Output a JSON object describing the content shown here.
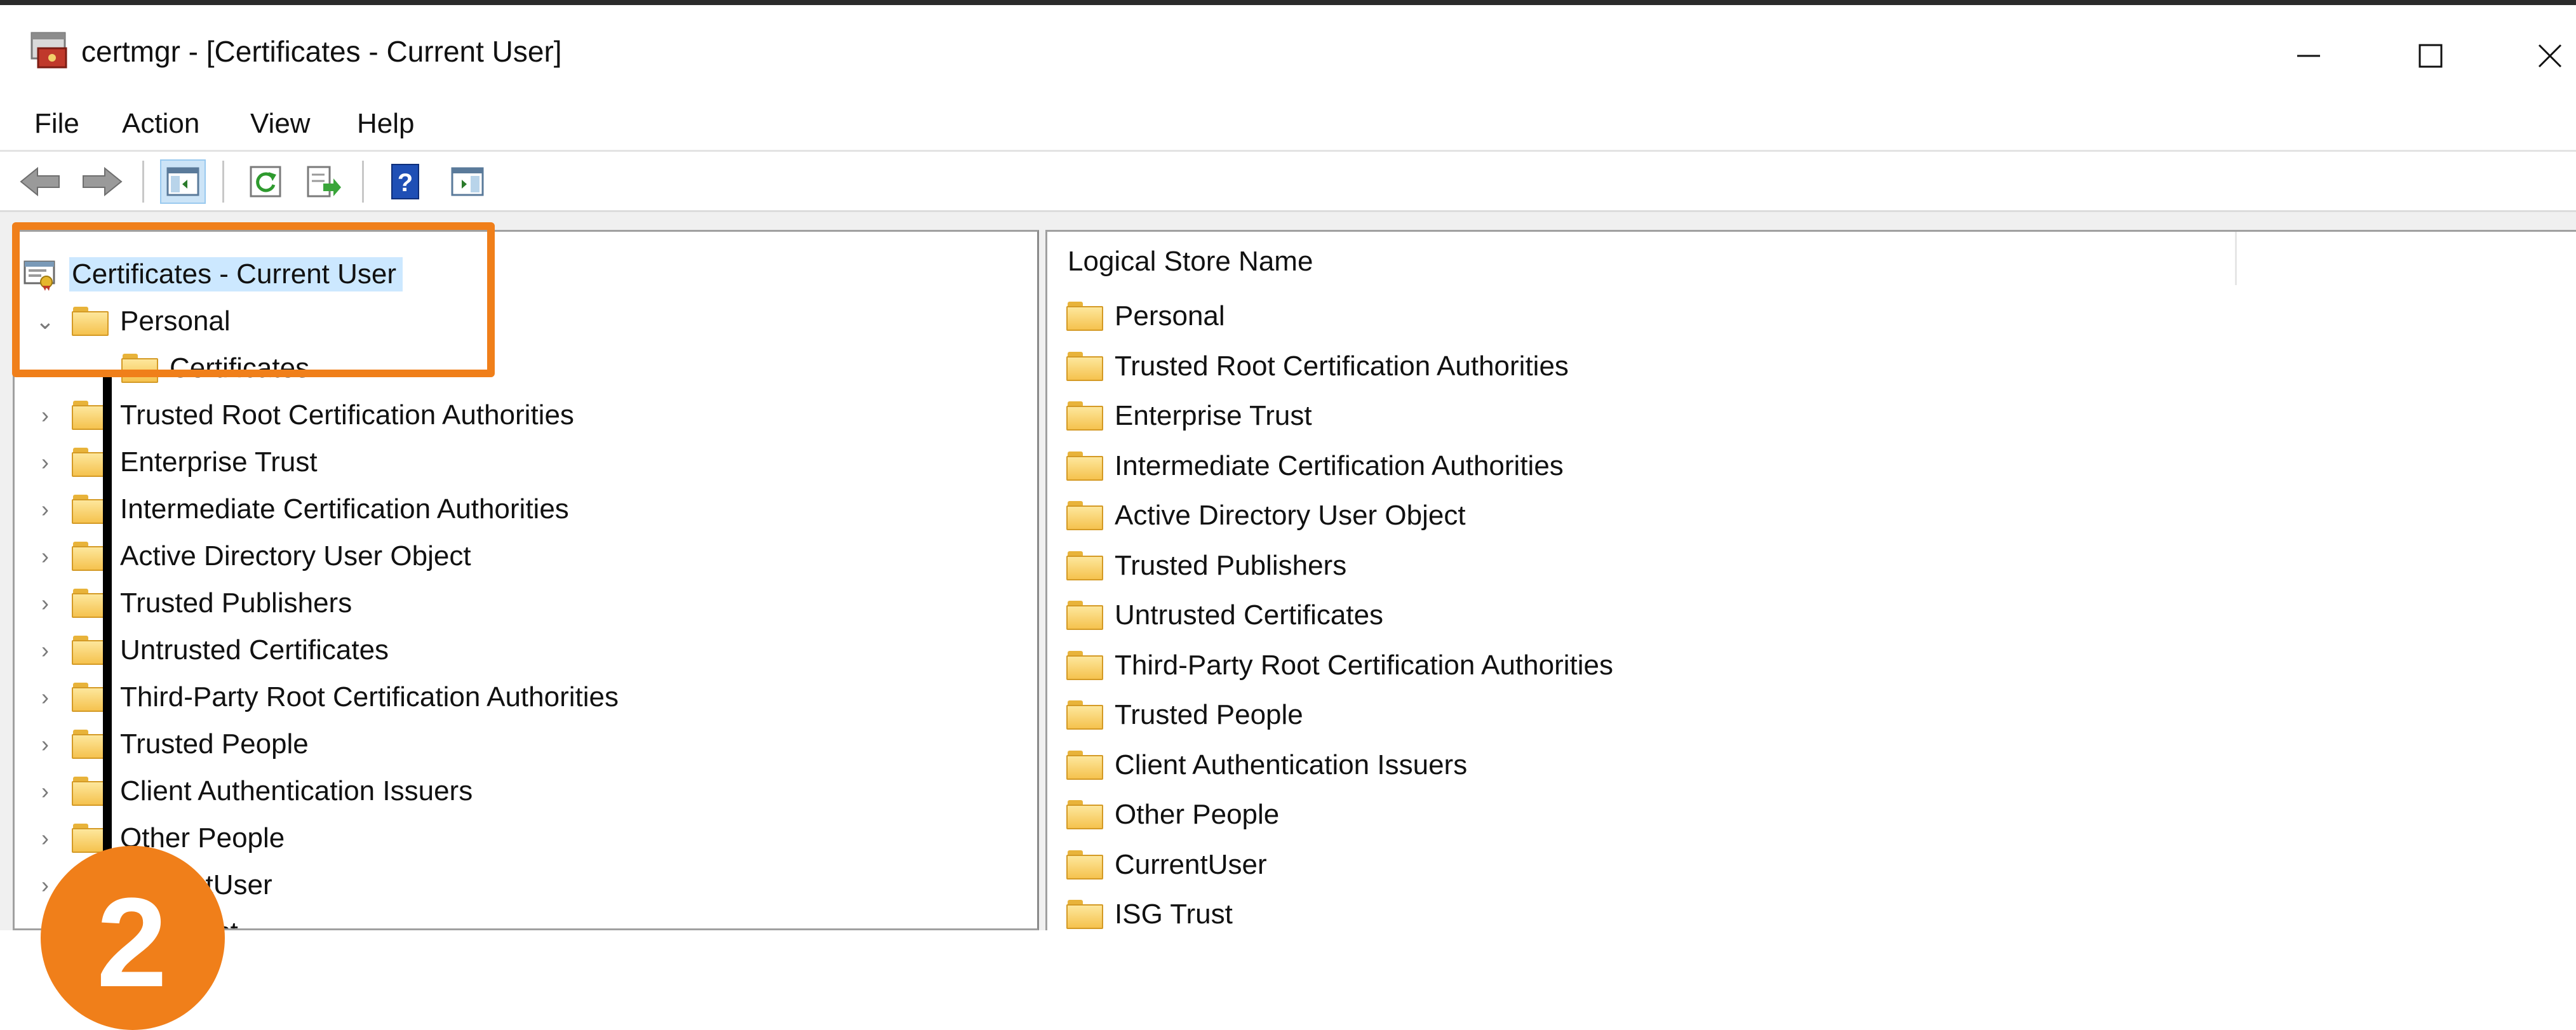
{
  "window": {
    "title": "certmgr - [Certificates - Current User]"
  },
  "menu": [
    "File",
    "Action",
    "View",
    "Help"
  ],
  "toolbar": {
    "back": "back-arrow-icon",
    "forward": "forward-arrow-icon",
    "show_tree": "show-hide-console-tree-icon",
    "refresh": "refresh-icon",
    "export": "export-list-icon",
    "help": "help-icon",
    "action_pane": "show-action-pane-icon"
  },
  "tree": {
    "root": "Certificates - Current User",
    "personal": "Personal",
    "personal_child": "Certificates",
    "items": [
      "Trusted Root Certification Authorities",
      "Enterprise Trust",
      "Intermediate Certification Authorities",
      "Active Directory User Object",
      "Trusted Publishers",
      "Untrusted Certificates",
      "Third-Party Root Certification Authorities",
      "Trusted People",
      "Client Authentication Issuers",
      "Other People",
      "CurrentUser",
      "ISG Trust"
    ]
  },
  "list": {
    "column_header": "Logical Store Name",
    "items": [
      "Personal",
      "Trusted Root Certification Authorities",
      "Enterprise Trust",
      "Intermediate Certification Authorities",
      "Active Directory User Object",
      "Trusted Publishers",
      "Untrusted Certificates",
      "Third-Party Root Certification Authorities",
      "Trusted People",
      "Client Authentication Issuers",
      "Other People",
      "CurrentUser",
      "ISG Trust"
    ]
  },
  "annotation": {
    "step_number": "2",
    "color": "#f07f1a"
  },
  "colors": {
    "selection": "#cce8ff",
    "folder": "#f5c24e",
    "accent": "#f07f1a"
  }
}
